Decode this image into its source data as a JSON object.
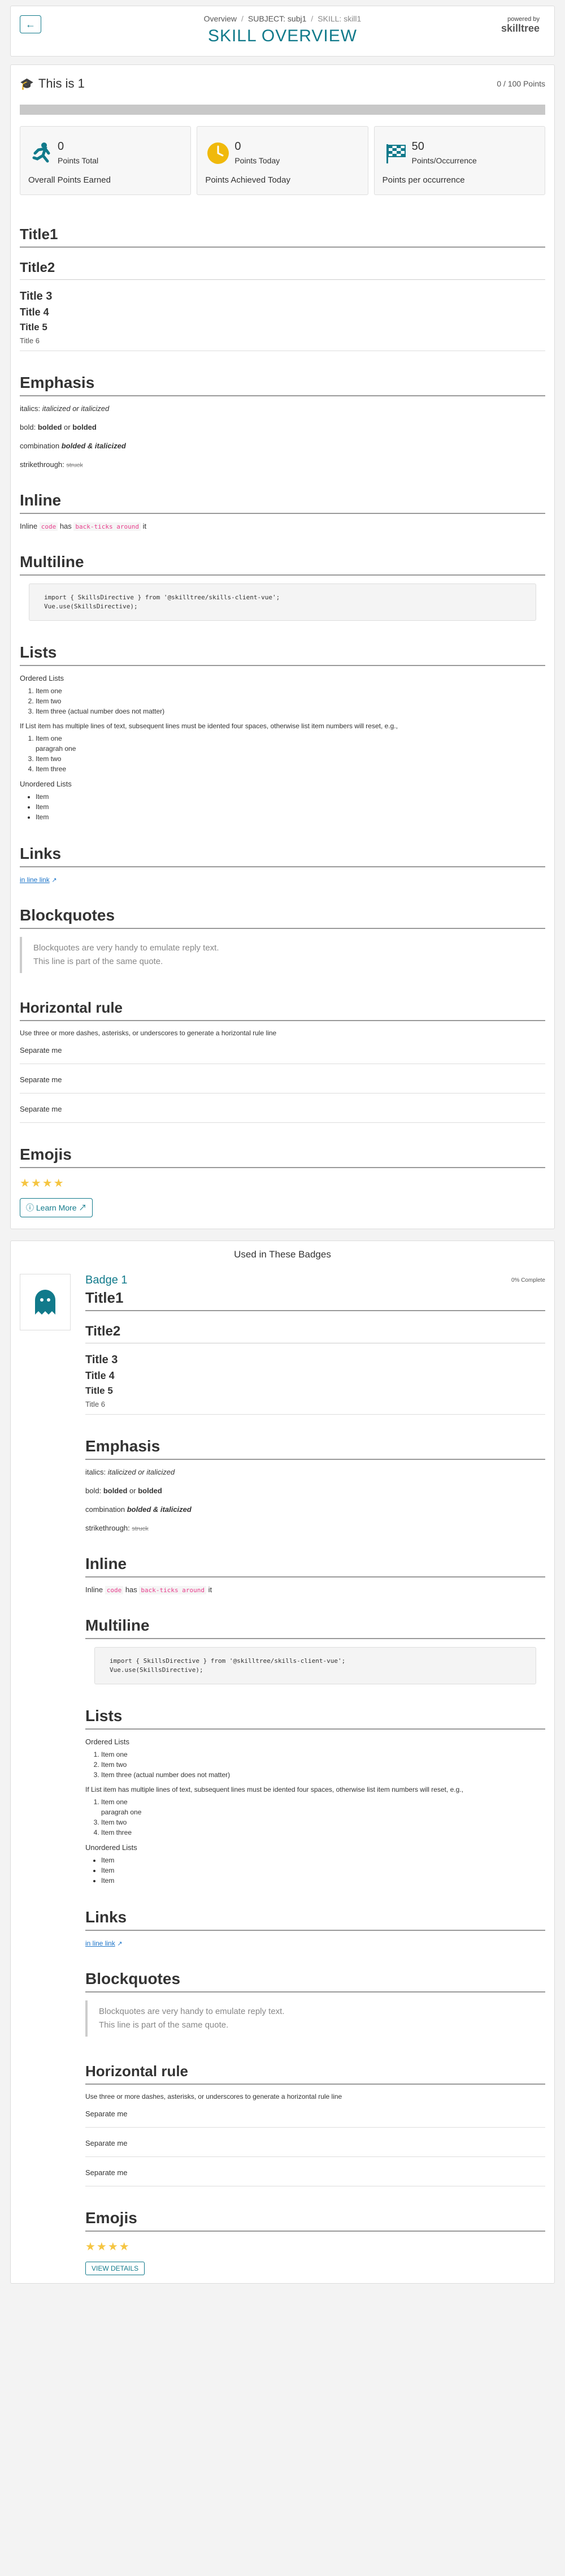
{
  "header": {
    "breadcrumb": [
      "Overview",
      "SUBJECT: subj1",
      "SKILL: skill1"
    ],
    "title": "SKILL OVERVIEW",
    "powered_by": "powered by",
    "logo": "skilltree"
  },
  "skill": {
    "name": "This is 1",
    "points": "0 / 100 Points",
    "progress": 0
  },
  "stats": [
    {
      "num": "0",
      "label": "Points Total",
      "sub": "Overall Points Earned",
      "icon": "runner-icon",
      "color": "#117a8b"
    },
    {
      "num": "0",
      "label": "Points Today",
      "sub": "Points Achieved Today",
      "icon": "clock-icon",
      "color": "#f0b90b"
    },
    {
      "num": "50",
      "label": "Points/Occurrence",
      "sub": "Points per occurrence",
      "icon": "checkered-flag-icon",
      "color": "#117a8b"
    }
  ],
  "md": {
    "h1": "Title1",
    "h2": "Title2",
    "h3": "Title 3",
    "h4": "Title 4",
    "h5": "Title 5",
    "h6": "Title 6",
    "emphasis": "Emphasis",
    "italics_lbl": "italics: ",
    "italics_val": "italicized or italicized",
    "bold_lbl": "bold: ",
    "bold_a": "bolded",
    "bold_or": " or ",
    "bold_b": "bolded",
    "comb_lbl": "combination ",
    "comb_val": "bolded & italicized",
    "strike_lbl": "strikethrough: ",
    "strike_val": "struck",
    "inline": "Inline",
    "inline_a": "Inline ",
    "inline_code1": "code",
    "inline_b": " has ",
    "inline_code2": "back-ticks around",
    "inline_c": " it",
    "multiline": "Multiline",
    "code_l1": "import { SkillsDirective } from '@skilltree/skills-client-vue';",
    "code_l2": "Vue.use(SkillsDirective);",
    "lists": "Lists",
    "ordered": "Ordered Lists",
    "ol": [
      "Item one",
      "Item two",
      "Item three (actual number does not matter)"
    ],
    "note": "If List item has multiple lines of text, subsequent lines must be idented four spaces, otherwise list item numbers will reset, e.g.,",
    "ol2": [
      "Item one",
      "paragrah one",
      "Item two",
      "Item three"
    ],
    "unordered": "Unordered Lists",
    "ul": [
      "Item",
      "Item",
      "Item"
    ],
    "links": "Links",
    "link": "in line link",
    "blockquotes": "Blockquotes",
    "q1": "Blockquotes are very handy to emulate reply text.",
    "q2": "This line is part of the same quote.",
    "hrule": "Horizontal rule",
    "hr_text": "Use three or more dashes, asterisks, or underscores to generate a horizontal rule line",
    "sep": "Separate me",
    "emojis": "Emojis",
    "stars": "★★★★"
  },
  "learn_more": "Learn More",
  "badges": {
    "header": "Used in These Badges",
    "name": "Badge 1",
    "pct": "0% Complete",
    "view": "VIEW DETAILS"
  }
}
